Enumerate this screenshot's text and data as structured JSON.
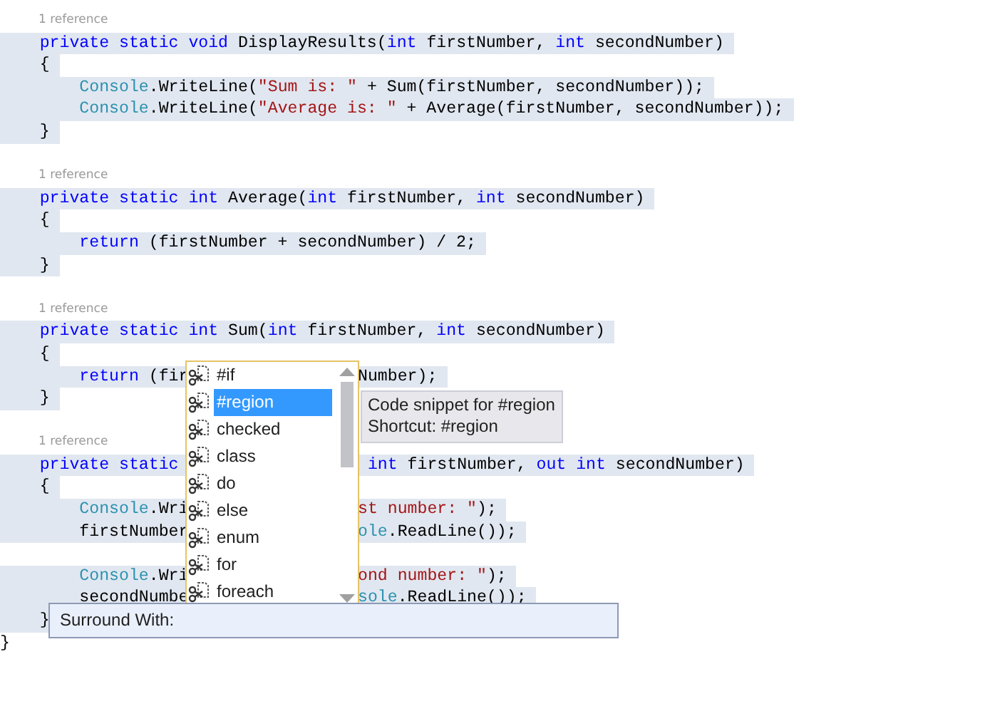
{
  "code_lines": [
    {
      "kind": "lens",
      "text": "1 reference"
    },
    {
      "kind": "code",
      "selected": true,
      "tokens": [
        {
          "kind": "keyword",
          "text": "    private static void"
        },
        {
          "kind": "plain",
          "text": " DisplayResults("
        },
        {
          "kind": "keyword",
          "text": "int"
        },
        {
          "kind": "plain",
          "text": " firstNumber, "
        },
        {
          "kind": "keyword",
          "text": "int"
        },
        {
          "kind": "plain",
          "text": " secondNumber)"
        }
      ]
    },
    {
      "kind": "code",
      "selected": true,
      "tokens": [
        {
          "kind": "plain",
          "text": "    {"
        }
      ]
    },
    {
      "kind": "code",
      "selected": true,
      "tokens": [
        {
          "kind": "type",
          "text": "        Console"
        },
        {
          "kind": "plain",
          "text": ".WriteLine("
        },
        {
          "kind": "string",
          "text": "\"Sum is: \""
        },
        {
          "kind": "plain",
          "text": " + Sum(firstNumber, secondNumber));"
        }
      ]
    },
    {
      "kind": "code",
      "selected": true,
      "tokens": [
        {
          "kind": "type",
          "text": "        Console"
        },
        {
          "kind": "plain",
          "text": ".WriteLine("
        },
        {
          "kind": "string",
          "text": "\"Average is: \""
        },
        {
          "kind": "plain",
          "text": " + Average(firstNumber, secondNumber));"
        }
      ]
    },
    {
      "kind": "code",
      "selected": true,
      "tokens": [
        {
          "kind": "plain",
          "text": "    }"
        }
      ]
    },
    {
      "kind": "blank"
    },
    {
      "kind": "lens",
      "text": "1 reference"
    },
    {
      "kind": "code",
      "selected": true,
      "tokens": [
        {
          "kind": "keyword",
          "text": "    private static int"
        },
        {
          "kind": "plain",
          "text": " Average("
        },
        {
          "kind": "keyword",
          "text": "int"
        },
        {
          "kind": "plain",
          "text": " firstNumber, "
        },
        {
          "kind": "keyword",
          "text": "int"
        },
        {
          "kind": "plain",
          "text": " secondNumber)"
        }
      ]
    },
    {
      "kind": "code",
      "selected": true,
      "tokens": [
        {
          "kind": "plain",
          "text": "    {"
        }
      ]
    },
    {
      "kind": "code",
      "selected": true,
      "tokens": [
        {
          "kind": "keyword",
          "text": "        return"
        },
        {
          "kind": "plain",
          "text": " (firstNumber + secondNumber) / 2;"
        }
      ]
    },
    {
      "kind": "code",
      "selected": true,
      "tokens": [
        {
          "kind": "plain",
          "text": "    }"
        }
      ]
    },
    {
      "kind": "blank"
    },
    {
      "kind": "lens",
      "text": "1 reference"
    },
    {
      "kind": "code",
      "selected": true,
      "tokens": [
        {
          "kind": "keyword",
          "text": "    private static int"
        },
        {
          "kind": "plain",
          "text": " Sum("
        },
        {
          "kind": "keyword",
          "text": "int"
        },
        {
          "kind": "plain",
          "text": " firstNumber, "
        },
        {
          "kind": "keyword",
          "text": "int"
        },
        {
          "kind": "plain",
          "text": " secondNumber)"
        }
      ]
    },
    {
      "kind": "code",
      "selected": true,
      "tokens": [
        {
          "kind": "plain",
          "text": "    {"
        }
      ]
    },
    {
      "kind": "code",
      "selected": true,
      "tokens": [
        {
          "kind": "keyword",
          "text": "        return"
        },
        {
          "kind": "plain",
          "text": " (fir"
        }
      ],
      "tail": [
        {
          "kind": "plain",
          "text": "Number);"
        }
      ]
    },
    {
      "kind": "code",
      "selected": true,
      "tokens": [
        {
          "kind": "plain",
          "text": "    }"
        }
      ]
    },
    {
      "kind": "blank"
    },
    {
      "kind": "lens",
      "text": "1 reference"
    },
    {
      "kind": "code",
      "selected": true,
      "tokens": [
        {
          "kind": "keyword",
          "text": "    private static"
        }
      ],
      "tail": [
        {
          "kind": "keyword",
          "text": " int"
        },
        {
          "kind": "plain",
          "text": " firstNumber, "
        },
        {
          "kind": "keyword",
          "text": "out int"
        },
        {
          "kind": "plain",
          "text": " secondNumber)"
        }
      ]
    },
    {
      "kind": "code",
      "selected": true,
      "tokens": [
        {
          "kind": "plain",
          "text": "    {"
        }
      ]
    },
    {
      "kind": "code",
      "selected": true,
      "tokens": [
        {
          "kind": "type",
          "text": "        Console"
        },
        {
          "kind": "plain",
          "text": ".Wri"
        }
      ],
      "tail": [
        {
          "kind": "string",
          "text": "st number: \""
        },
        {
          "kind": "plain",
          "text": ");"
        }
      ]
    },
    {
      "kind": "code",
      "selected": true,
      "tokens": [
        {
          "kind": "plain",
          "text": "        firstNumber"
        }
      ],
      "tail": [
        {
          "kind": "type",
          "text": "ole"
        },
        {
          "kind": "plain",
          "text": ".ReadLine());"
        }
      ]
    },
    {
      "kind": "blank"
    },
    {
      "kind": "code",
      "selected": true,
      "tokens": [
        {
          "kind": "type",
          "text": "        Console"
        },
        {
          "kind": "plain",
          "text": ".Wri"
        }
      ],
      "tail": [
        {
          "kind": "string",
          "text": "ond number: \""
        },
        {
          "kind": "plain",
          "text": ");"
        }
      ]
    },
    {
      "kind": "code",
      "selected": true,
      "tokens": [
        {
          "kind": "plain",
          "text": "        secondNumbe"
        }
      ],
      "tail": [
        {
          "kind": "type",
          "text": "sole"
        },
        {
          "kind": "plain",
          "text": ".ReadLine());"
        }
      ]
    },
    {
      "kind": "code",
      "selected": true,
      "tokens": [
        {
          "kind": "plain",
          "text": "    }"
        }
      ]
    },
    {
      "kind": "code",
      "selected": false,
      "tokens": [
        {
          "kind": "plain",
          "text": "}"
        }
      ]
    }
  ],
  "completion_list": {
    "items": [
      {
        "label": "#if",
        "selected": false
      },
      {
        "label": "#region",
        "selected": true
      },
      {
        "label": "checked",
        "selected": false
      },
      {
        "label": "class",
        "selected": false
      },
      {
        "label": "do",
        "selected": false
      },
      {
        "label": "else",
        "selected": false
      },
      {
        "label": "enum",
        "selected": false
      },
      {
        "label": "for",
        "selected": false
      },
      {
        "label": "foreach",
        "selected": false
      }
    ]
  },
  "tooltip": {
    "lines": [
      "Code snippet for #region",
      "Shortcut: #region"
    ]
  },
  "surround_with": {
    "label": "Surround With:"
  }
}
